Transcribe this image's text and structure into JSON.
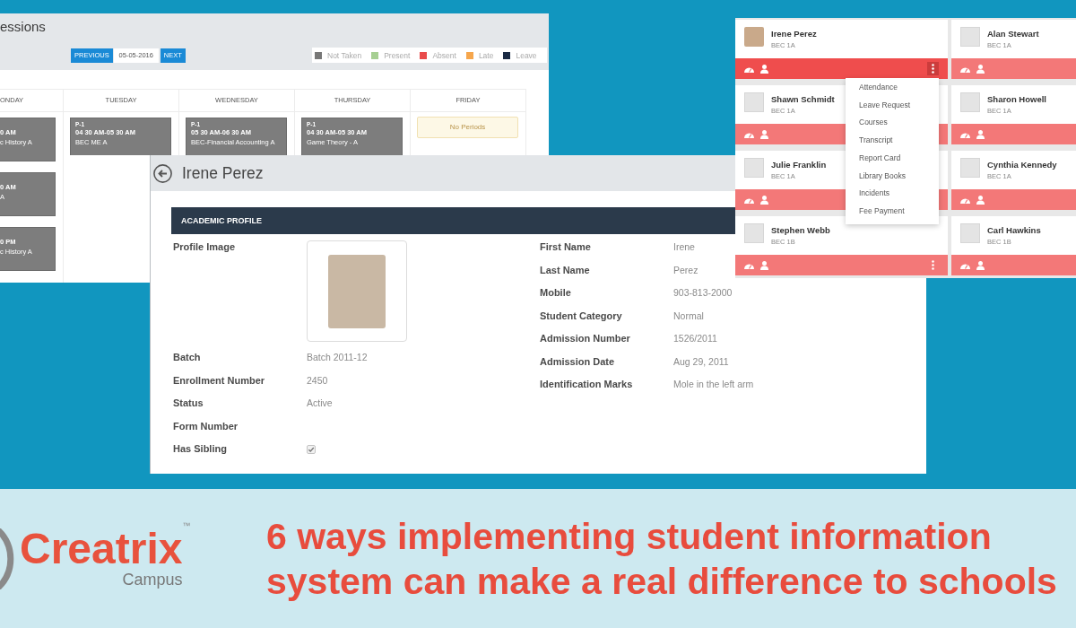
{
  "sessions_panel": {
    "title": "essions",
    "previous_button": "PREVIOUS",
    "date": "05-05-2016",
    "next_button": "NEXT",
    "legend": [
      {
        "label": "Not Taken",
        "color": "#777777"
      },
      {
        "label": "Present",
        "color": "#a6cf92"
      },
      {
        "label": "Absent",
        "color": "#e94b4b"
      },
      {
        "label": "Late",
        "color": "#f6a64c"
      },
      {
        "label": "Leave",
        "color": "#1b2b44"
      }
    ],
    "days": [
      {
        "name": "ONDAY",
        "periods": [
          {
            "time": "0 AM",
            "subject": "c History A"
          },
          {
            "time": "0 AM",
            "subject": "A"
          },
          {
            "time": "0 PM",
            "subject": "c History A"
          }
        ]
      },
      {
        "name": "TUESDAY",
        "periods": [
          {
            "period": "P-1",
            "time": "04 30 AM-05 30 AM",
            "subject": "BEC ME A"
          }
        ]
      },
      {
        "name": "WEDNESDAY",
        "periods": [
          {
            "period": "P-1",
            "time": "05 30 AM-06 30 AM",
            "subject": "BEC-Financial Accounting A"
          }
        ]
      },
      {
        "name": "THURSDAY",
        "periods": [
          {
            "period": "P-1",
            "time": "04 30 AM-05 30 AM",
            "subject": "Game Theory - A"
          }
        ]
      },
      {
        "name": "FRIDAY",
        "empty_message": "No Periods"
      }
    ]
  },
  "profile_panel": {
    "title": "Irene Perez",
    "section_title": "ACADEMIC PROFILE",
    "left_fields": [
      {
        "kind": "image",
        "label": "Profile Image"
      },
      {
        "kind": "text",
        "label": "Batch",
        "value": "Batch 2011-12"
      },
      {
        "kind": "text",
        "label": "Enrollment Number",
        "value": "2450"
      },
      {
        "kind": "text",
        "label": "Status",
        "value": "Active"
      },
      {
        "kind": "text",
        "label": "Form Number"
      },
      {
        "kind": "checkbox",
        "label": "Has Sibling",
        "checked": true
      }
    ],
    "right_fields": [
      {
        "label": "First Name",
        "value": "Irene"
      },
      {
        "label": "Last Name",
        "value": "Perez"
      },
      {
        "label": "Mobile",
        "value": "903-813-2000"
      },
      {
        "label": "Student Category",
        "value": "Normal"
      },
      {
        "label": "Admission Number",
        "value": "1526/2011"
      },
      {
        "label": "Admission Date",
        "value": "Aug 29, 2011"
      },
      {
        "label": "Identification Marks",
        "value": "Mole in the left arm"
      }
    ]
  },
  "students_panel": {
    "students": [
      {
        "name": "Irene Perez",
        "class": "BEC 1A",
        "photo": true,
        "active": true,
        "menu_button": true
      },
      {
        "name": "Alan Stewart",
        "class": "BEC 1A",
        "photo": false,
        "active": false,
        "menu_button": false
      },
      {
        "name": "Shawn Schmidt",
        "class": "BEC 1A",
        "photo": false,
        "active": false,
        "menu_button": false
      },
      {
        "name": "Sharon Howell",
        "class": "BEC 1A",
        "photo": false,
        "active": false,
        "menu_button": false
      },
      {
        "name": "Julie Franklin",
        "class": "BEC 1A",
        "photo": false,
        "active": false,
        "menu_button": false
      },
      {
        "name": "Cynthia Kennedy",
        "class": "BEC 1A",
        "photo": false,
        "active": false,
        "menu_button": false
      },
      {
        "name": "Stephen Webb",
        "class": "BEC 1B",
        "photo": false,
        "active": false,
        "menu_button": true
      },
      {
        "name": "Carl Hawkins",
        "class": "BEC 1B",
        "photo": false,
        "active": false,
        "menu_button": false
      }
    ],
    "dropdown_menu": [
      "Attendance",
      "Leave Request",
      "Courses",
      "Transcript",
      "Report Card",
      "Library Books",
      "Incidents",
      "Fee Payment"
    ]
  },
  "banner": {
    "logo_name": "Creatrix",
    "logo_trademark": "™",
    "logo_tagline": "Campus",
    "headline": "6 ways implementing student information system can make a real difference to schools"
  }
}
